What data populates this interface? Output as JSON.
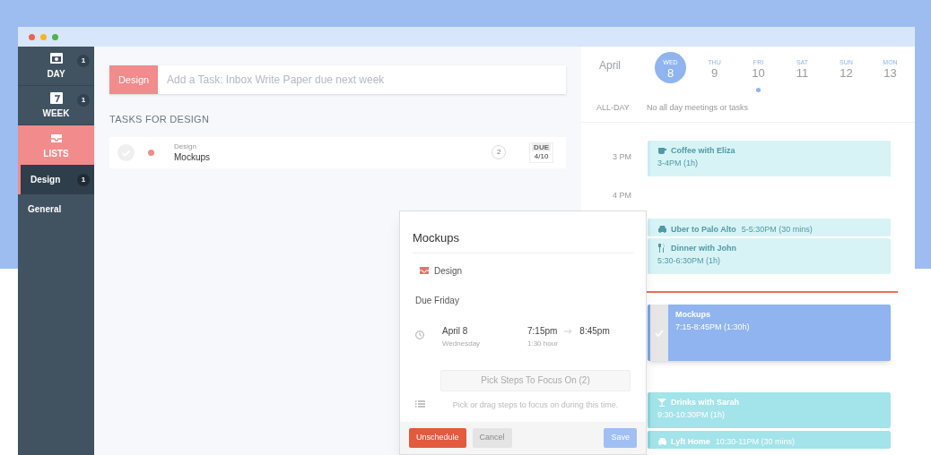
{
  "sidebar": {
    "nav": [
      {
        "kind": "day",
        "label": "DAY",
        "count": "1",
        "selected": false
      },
      {
        "kind": "week",
        "label": "WEEK",
        "count": "1",
        "selected": false
      },
      {
        "kind": "lists",
        "label": "LISTS",
        "selected": true
      }
    ],
    "lists": [
      {
        "label": "Design",
        "count": "1",
        "selected": true
      },
      {
        "label": "General",
        "selected": false
      }
    ]
  },
  "task_input": {
    "list": "Design",
    "placeholder": "Add a Task: Inbox Write Paper due next week"
  },
  "section_title": "TASKS FOR DESIGN",
  "tasks": [
    {
      "list": "Design",
      "title": "Mockups",
      "steps": "2",
      "due_label": "DUE",
      "due": "4/10",
      "color": "#f28b8b"
    }
  ],
  "calendar": {
    "month": "April",
    "days": [
      {
        "weekday": "WED",
        "date": "8",
        "selected": true,
        "has_items": false
      },
      {
        "weekday": "THU",
        "date": "9",
        "selected": false,
        "has_items": false
      },
      {
        "weekday": "FRI",
        "date": "10",
        "selected": false,
        "has_items": true
      },
      {
        "weekday": "SAT",
        "date": "11",
        "selected": false,
        "has_items": false
      },
      {
        "weekday": "SUN",
        "date": "12",
        "selected": false,
        "has_items": false
      },
      {
        "weekday": "MON",
        "date": "13",
        "selected": false,
        "has_items": false
      }
    ],
    "all_day_label": "ALL-DAY",
    "all_day_text": "No all day meetings or tasks",
    "hours": [
      "3 PM",
      "4 PM"
    ],
    "events": [
      {
        "kind": "coffee",
        "title": "Coffee with Eliza",
        "time": "3-4PM (1h)",
        "past": true
      },
      {
        "kind": "car",
        "title": "Uber to Palo Alto",
        "time": "5-5:30PM (30 mins)",
        "past": true
      },
      {
        "kind": "meal",
        "title": "Dinner with John",
        "time": "5:30-6:30PM (1h)",
        "past": true
      },
      {
        "kind": "task",
        "title": "Mockups",
        "time": "7:15-8:45PM (1:30h)",
        "past": false
      },
      {
        "kind": "drinks",
        "title": "Drinks with Sarah",
        "time": "9:30-10:30PM (1h)",
        "past": false
      },
      {
        "kind": "car",
        "title": "Lyft Home",
        "time": "10:30-11PM (30 mins)",
        "past": false
      }
    ]
  },
  "popup": {
    "title": "Mockups",
    "list": "Design",
    "due": "Due Friday",
    "date": "April 8",
    "weekday": "Wednesday",
    "start": "7:15pm",
    "end": "8:45pm",
    "duration": "1:30 hour",
    "steps_button": "Pick Steps To Focus On (2)",
    "steps_hint": "Pick or drag steps to focus on during this time.",
    "buttons": [
      {
        "kind": "danger",
        "label": "Unschedule"
      },
      {
        "kind": "muted",
        "label": "Cancel"
      },
      {
        "kind": "primary",
        "label": "Save"
      }
    ]
  }
}
